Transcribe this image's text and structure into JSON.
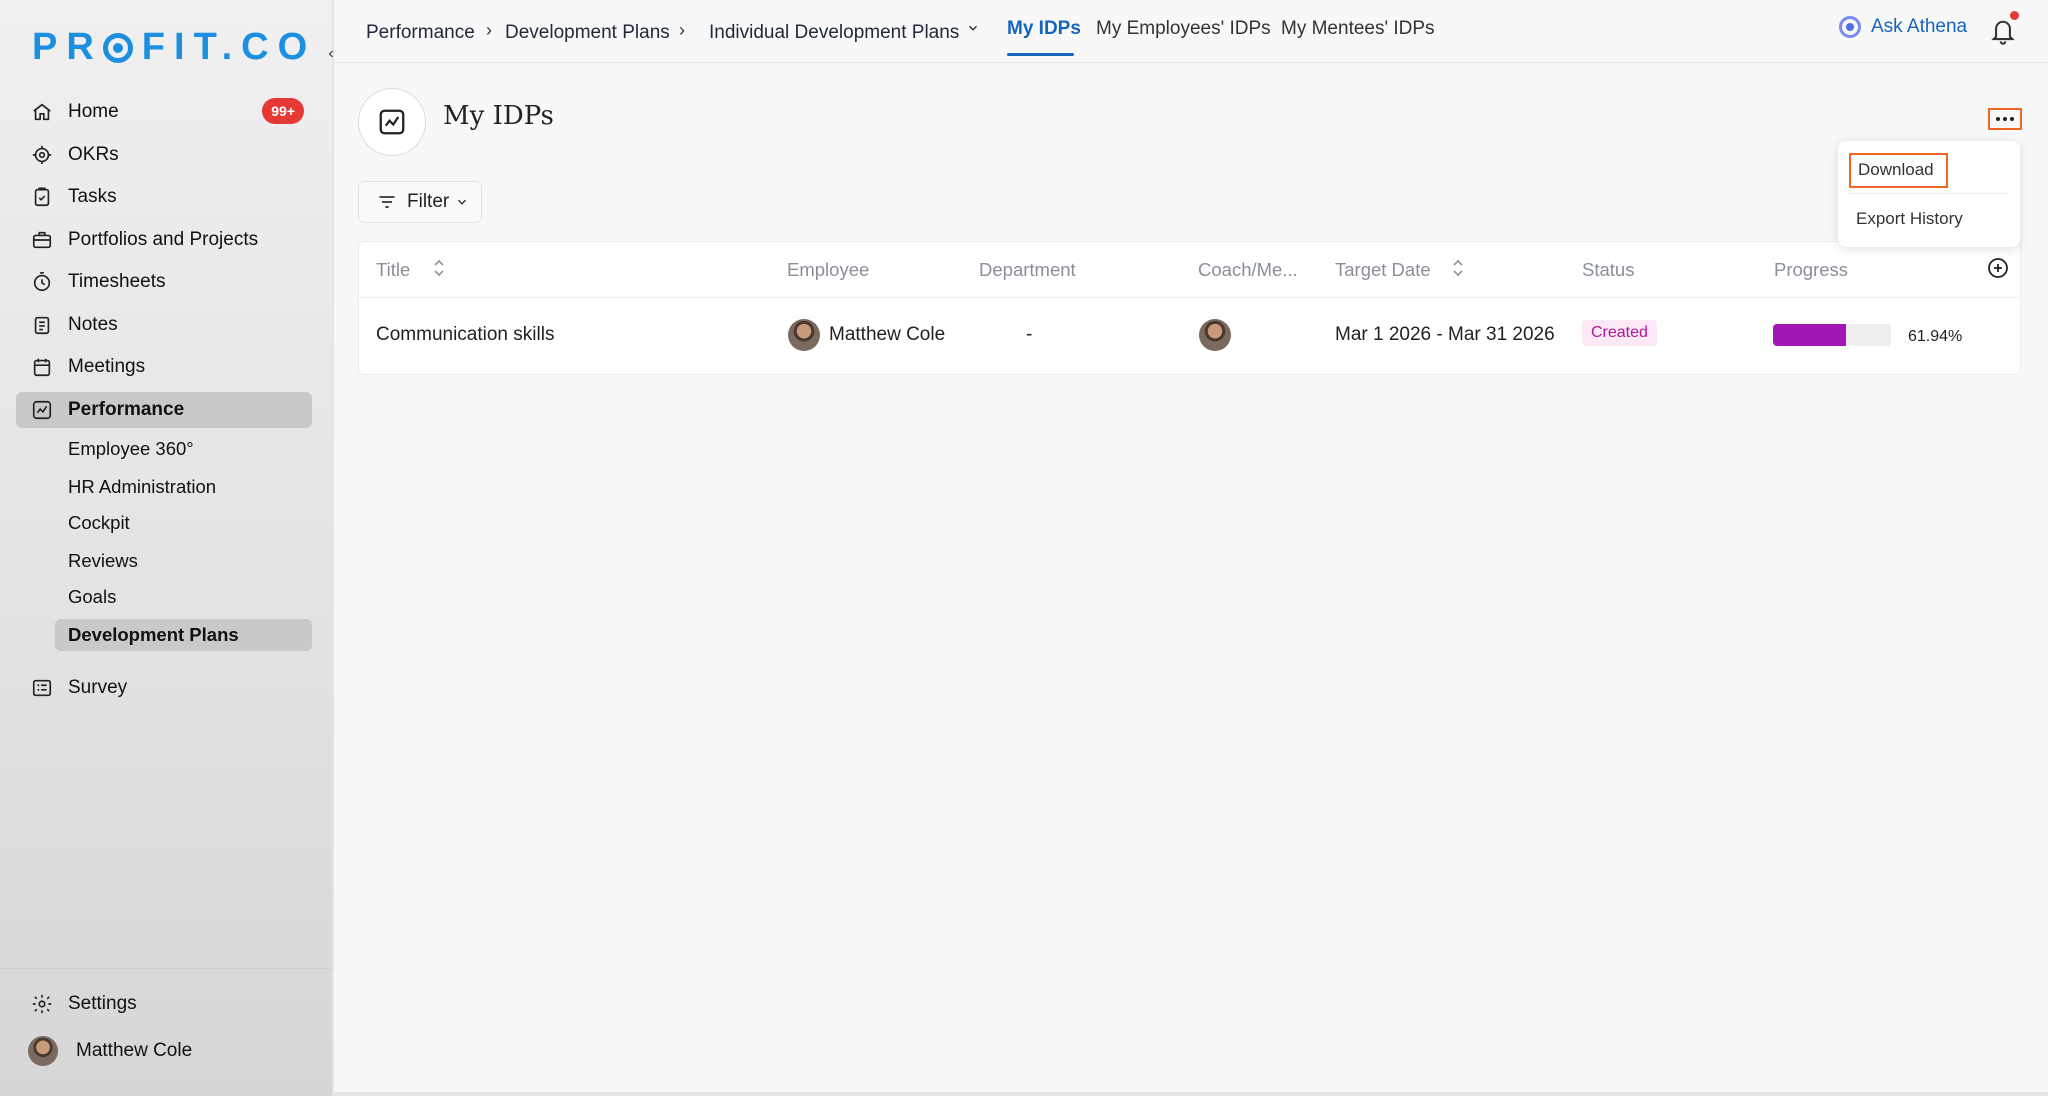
{
  "brand": {
    "logo_left": "PR",
    "logo_right": "FIT.CO"
  },
  "sidebar": {
    "items": [
      {
        "label": "Home",
        "icon": "home-icon",
        "badge": "99+"
      },
      {
        "label": "OKRs",
        "icon": "target-icon"
      },
      {
        "label": "Tasks",
        "icon": "clipboard-check-icon"
      },
      {
        "label": "Portfolios and Projects",
        "icon": "briefcase-icon"
      },
      {
        "label": "Timesheets",
        "icon": "stopwatch-icon"
      },
      {
        "label": "Notes",
        "icon": "notes-icon"
      },
      {
        "label": "Meetings",
        "icon": "calendar-icon"
      },
      {
        "label": "Performance",
        "icon": "chart-line-icon"
      }
    ],
    "performance_sub": [
      {
        "label": "Employee 360°"
      },
      {
        "label": "HR Administration"
      },
      {
        "label": "Cockpit"
      },
      {
        "label": "Reviews"
      },
      {
        "label": "Goals"
      },
      {
        "label": "Development Plans"
      }
    ],
    "survey": {
      "label": "Survey",
      "icon": "survey-icon"
    },
    "settings": {
      "label": "Settings",
      "icon": "gear-icon"
    },
    "user": {
      "name": "Matthew Cole"
    }
  },
  "topbar": {
    "breadcrumb": [
      "Performance",
      "Development Plans",
      "Individual Development Plans"
    ],
    "tabs": [
      "My IDPs",
      "My Employees' IDPs",
      "My Mentees' IDPs"
    ],
    "active_tab": "My IDPs",
    "ask_label": "Ask Athena"
  },
  "page": {
    "title": "My IDPs",
    "filter_label": "Filter"
  },
  "table": {
    "columns": [
      "Title",
      "Employee",
      "Department",
      "Coach/Me...",
      "Target Date",
      "Status",
      "Progress"
    ],
    "rows": [
      {
        "title": "Communication skills",
        "employee": "Matthew Cole",
        "department": "-",
        "target_date": "Mar 1 2026 - Mar 31 2026",
        "status": "Created",
        "progress_text": "61.94%",
        "progress_value": 61.94
      }
    ]
  },
  "menu": {
    "items": [
      "Download",
      "Export History"
    ]
  },
  "colors": {
    "accent": "#1565c0",
    "badge": "#e53935",
    "progress": "#a116b5",
    "highlight": "#f26522"
  }
}
